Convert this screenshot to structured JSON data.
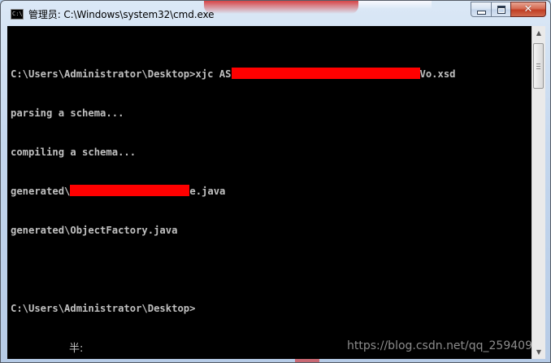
{
  "window": {
    "title": "管理员: C:\\Windows\\system32\\cmd.exe",
    "icon": "cmd-icon",
    "icon_text": "C:\\"
  },
  "caption_buttons": {
    "minimize": "minimize-icon",
    "maximize": "maximize-icon",
    "close": "close-icon",
    "close_glyph": "✕"
  },
  "console": {
    "colors": {
      "background": "#000000",
      "text": "#c0c0c0",
      "redaction": "#ff0000"
    },
    "lines": {
      "l1_prefix": "C:\\Users\\Administrator\\Desktop>xjc AS",
      "l1_suffix": "Vo.xsd",
      "l2": "parsing a schema...",
      "l3": "compiling a schema...",
      "l4_prefix": "generated\\",
      "l4_suffix": "e.java",
      "l5": "generated\\ObjectFactory.java",
      "l6": "",
      "l7": "C:\\Users\\Administrator\\Desktop>"
    },
    "ime_indicator": "半:"
  },
  "watermark": "https://blog.csdn.net/qq_259409",
  "scrollbar": {
    "up_glyph": "▲",
    "down_glyph": "▼"
  }
}
